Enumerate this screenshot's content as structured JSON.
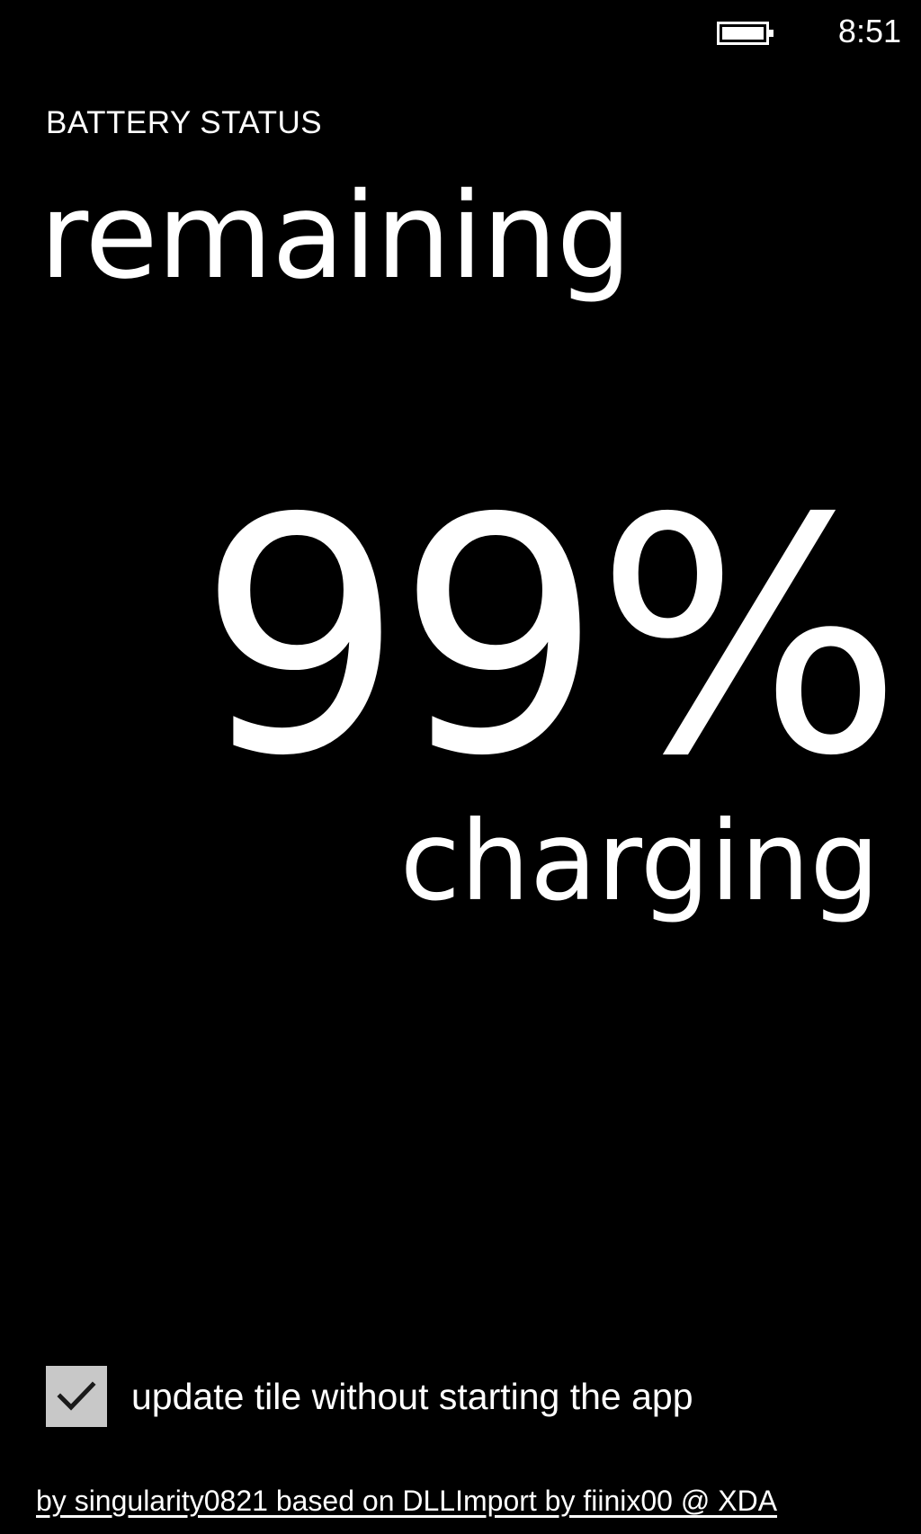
{
  "status_bar": {
    "battery_icon": "battery-icon",
    "time": "8:51"
  },
  "header": {
    "app_title": "BATTERY STATUS",
    "page_title": "remaining"
  },
  "battery": {
    "percent_text": "99%",
    "state": "charging"
  },
  "options": {
    "update_tile": {
      "label": "update tile without starting the app",
      "checked": true,
      "icon": "checkmark-icon"
    }
  },
  "footer": {
    "credits": "by singularity0821 based on DLLImport by fiinix00 @ XDA"
  },
  "colors": {
    "background": "#000000",
    "foreground": "#ffffff",
    "checkbox_fill": "#c8c8c8",
    "checkmark": "#1a1a1a"
  }
}
